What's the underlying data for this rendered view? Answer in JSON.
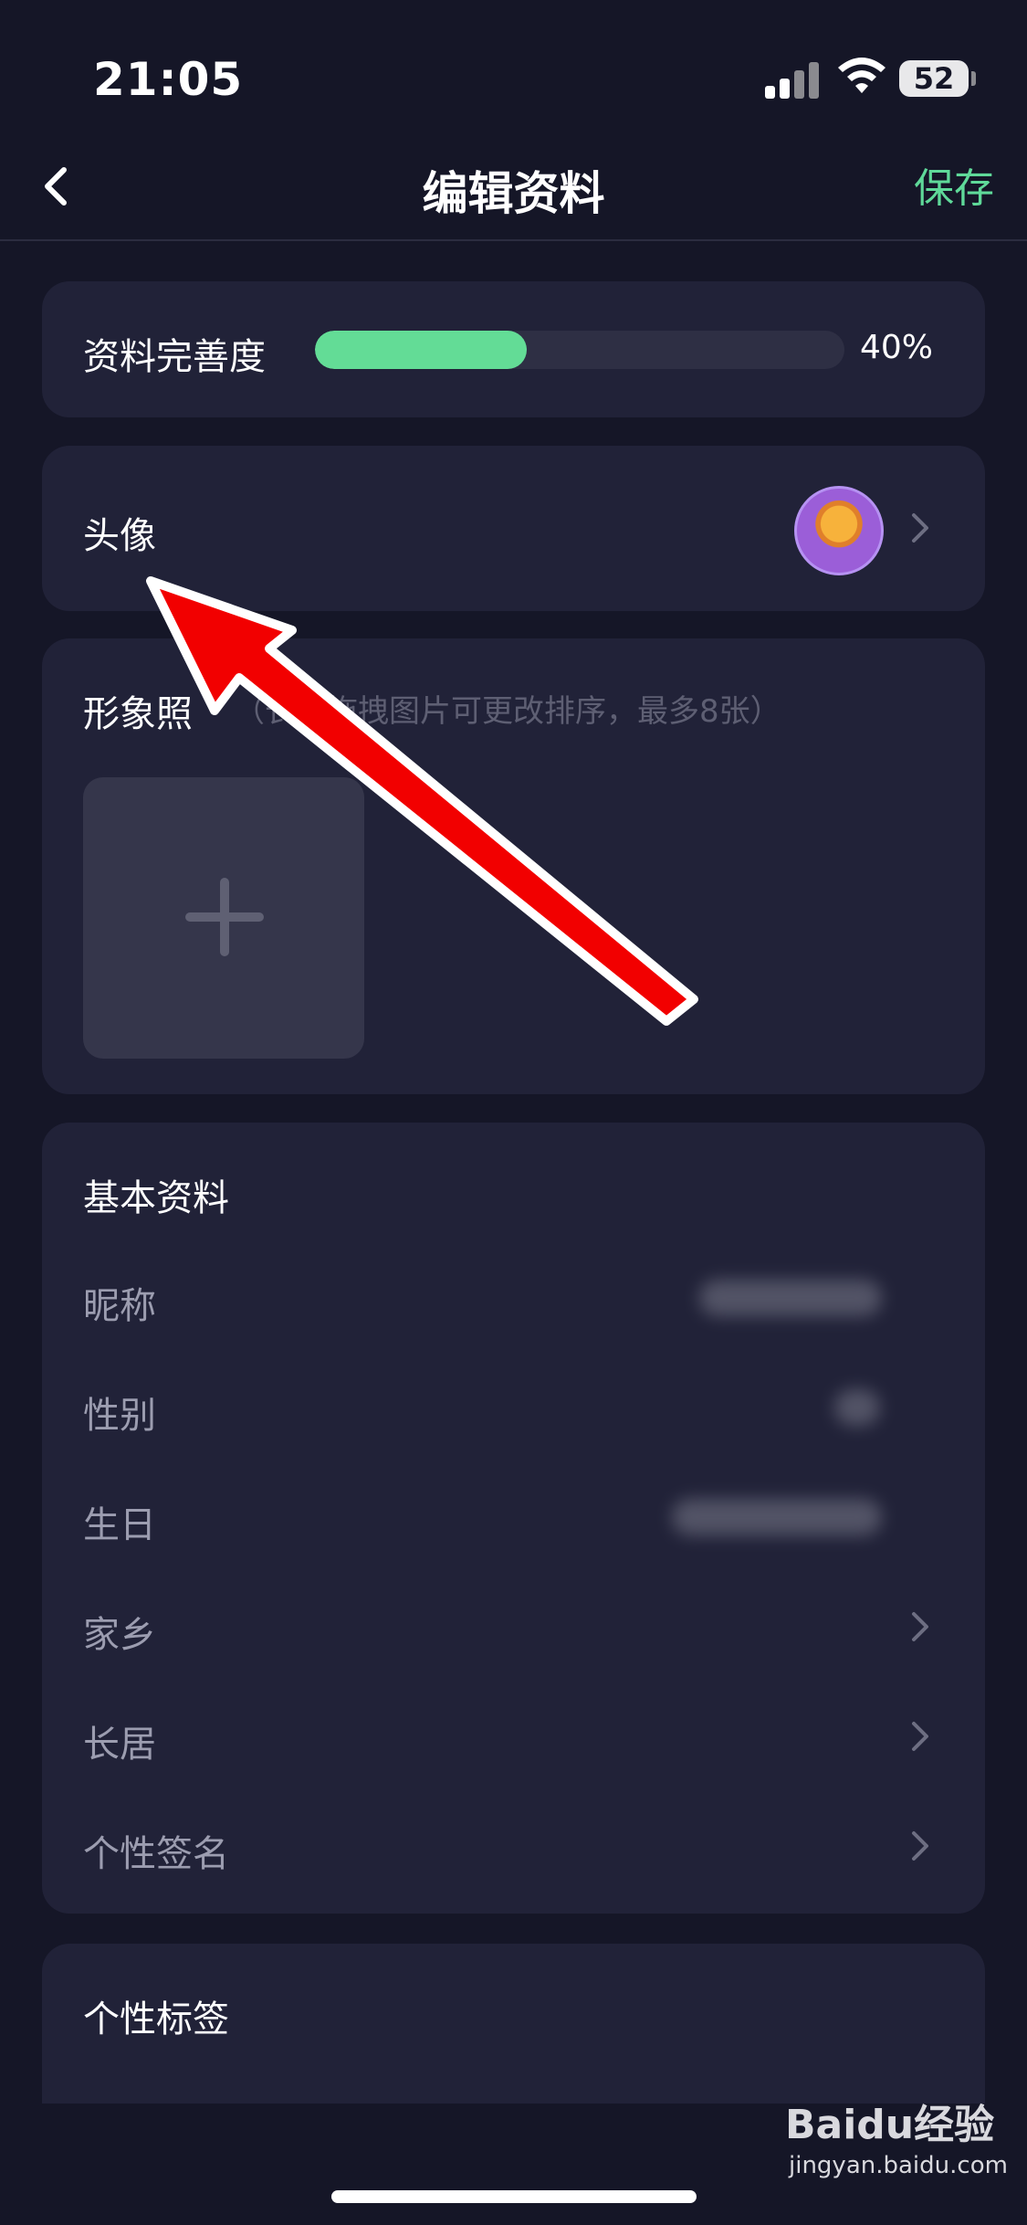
{
  "status_bar": {
    "time": "21:05",
    "battery": "52"
  },
  "nav": {
    "title": "编辑资料",
    "save_label": "保存"
  },
  "completeness": {
    "label": "资料完善度",
    "percent_text": "40%",
    "value": 0.4,
    "fill_color": "#63dc96"
  },
  "avatar_row": {
    "label": "头像"
  },
  "photos": {
    "title": "形象照",
    "hint": "（长按拖拽图片可更改排序，最多8张）"
  },
  "basic": {
    "title": "基本资料",
    "rows": [
      {
        "label": "昵称"
      },
      {
        "label": "性别"
      },
      {
        "label": "生日"
      },
      {
        "label": "家乡"
      },
      {
        "label": "长居"
      },
      {
        "label": "个性签名"
      }
    ]
  },
  "tags": {
    "title": "个性标签"
  },
  "watermark": {
    "logo": "Baidu经验",
    "url": "jingyan.baidu.com"
  },
  "colors": {
    "background": "#151627",
    "card": "#212238",
    "accent": "#5fd999",
    "annotation_arrow": "#ff0000"
  }
}
